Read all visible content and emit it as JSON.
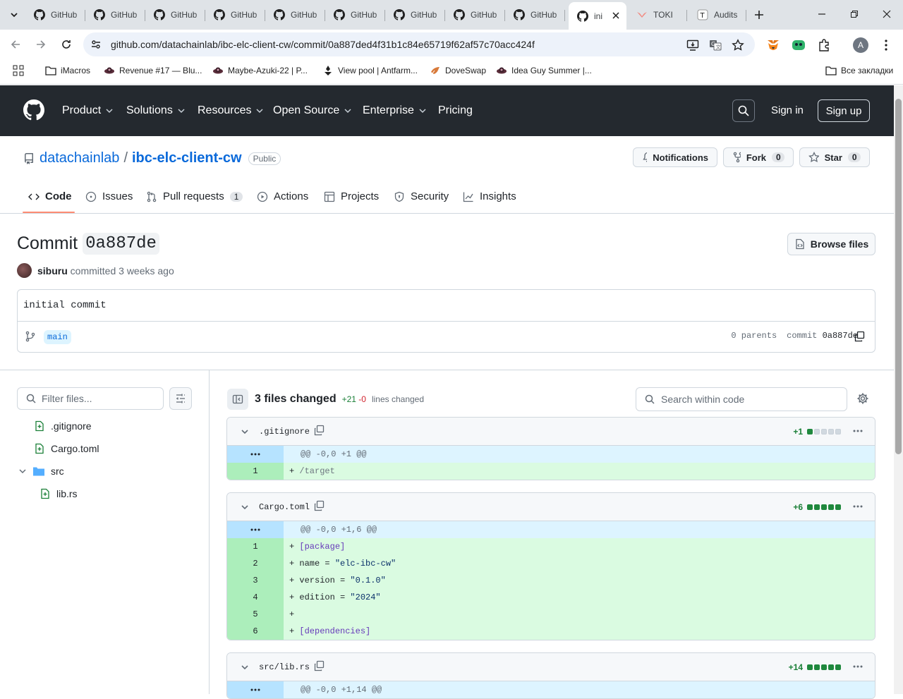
{
  "browser": {
    "tabs": [
      {
        "title": "GitHub",
        "icon": "github-icon"
      },
      {
        "title": "GitHub",
        "icon": "github-icon"
      },
      {
        "title": "GitHub",
        "icon": "github-icon"
      },
      {
        "title": "GitHub",
        "icon": "github-icon"
      },
      {
        "title": "GitHub",
        "icon": "github-icon"
      },
      {
        "title": "GitHub",
        "icon": "github-icon"
      },
      {
        "title": "GitHub",
        "icon": "github-icon"
      },
      {
        "title": "GitHub",
        "icon": "github-icon"
      },
      {
        "title": "GitHub",
        "icon": "github-icon"
      },
      {
        "title": "ini",
        "icon": "github-icon",
        "active": true
      },
      {
        "title": "TOKI",
        "icon": "toki-icon"
      },
      {
        "title": "Audits",
        "icon": "t-icon"
      }
    ],
    "url": "github.com/datachainlab/ibc-elc-client-cw/commit/0a887ded4f31b1c84e65719f62af57c70acc424f",
    "avatar_letter": "A",
    "bookmarks": [
      {
        "label": "iMacros",
        "icon": "folder-icon"
      },
      {
        "label": "Revenue #17 — Blu...",
        "icon": "ufo-icon"
      },
      {
        "label": "Maybe-Azuki-22 | P...",
        "icon": "ufo-icon"
      },
      {
        "label": "View pool | Antfarm...",
        "icon": "antfarm-icon"
      },
      {
        "label": "DoveSwap",
        "icon": "dove-icon"
      },
      {
        "label": "Idea Guy Summer |...",
        "icon": "ufo-icon"
      }
    ],
    "all_bookmarks": "Все закладки"
  },
  "gh_header": {
    "nav": [
      {
        "label": "Product",
        "dropdown": true
      },
      {
        "label": "Solutions",
        "dropdown": true
      },
      {
        "label": "Resources",
        "dropdown": true
      },
      {
        "label": "Open Source",
        "dropdown": true
      },
      {
        "label": "Enterprise",
        "dropdown": true
      },
      {
        "label": "Pricing",
        "dropdown": false
      }
    ],
    "signin": "Sign in",
    "signup": "Sign up"
  },
  "repo": {
    "owner": "datachainlab",
    "name": "ibc-elc-client-cw",
    "visibility": "Public",
    "notifications": "Notifications",
    "fork_label": "Fork",
    "fork_count": "0",
    "star_label": "Star",
    "star_count": "0",
    "tabs": [
      {
        "label": "Code",
        "icon": "code-icon",
        "selected": true
      },
      {
        "label": "Issues",
        "icon": "issue-icon"
      },
      {
        "label": "Pull requests",
        "icon": "pull-request-icon",
        "count": "1"
      },
      {
        "label": "Actions",
        "icon": "play-icon"
      },
      {
        "label": "Projects",
        "icon": "table-icon"
      },
      {
        "label": "Security",
        "icon": "shield-icon"
      },
      {
        "label": "Insights",
        "icon": "graph-icon"
      }
    ]
  },
  "commit": {
    "title_prefix": "Commit",
    "short_sha": "0a887de",
    "browse_files": "Browse files",
    "author": "siburu",
    "committed": "committed",
    "when": "3 weeks ago",
    "message": "initial commit",
    "branch": "main",
    "parents": "0 parents",
    "commit_label": "commit",
    "commit_sha": "0a887de"
  },
  "file_tree": {
    "filter_placeholder": "Filter files...",
    "items": [
      {
        "name": ".gitignore",
        "type": "file-added"
      },
      {
        "name": "Cargo.toml",
        "type": "file-added"
      },
      {
        "name": "src",
        "type": "folder"
      },
      {
        "name": "lib.rs",
        "type": "file-added"
      }
    ]
  },
  "diff": {
    "files_changed": "3 files changed",
    "additions": "+21",
    "deletions": "-0",
    "lines_changed": "lines changed",
    "search_placeholder": "Search within code",
    "colors": {
      "add_bg": "#dafbe1",
      "add_gutter": "#aceebb",
      "hunk_bg": "#ddf4ff",
      "hunk_gutter": "#b6e3ff"
    },
    "files": [
      {
        "name": ".gitignore",
        "stat": "+1",
        "hunk": "@@ -0,0 +1 @@",
        "lines": [
          {
            "n": "1",
            "text": "+ /target",
            "style": "tg"
          }
        ]
      },
      {
        "name": "Cargo.toml",
        "stat": "+6",
        "hunk": "@@ -0,0 +1,6 @@",
        "lines": [
          {
            "n": "1",
            "text": "+ [package]",
            "style": "kw"
          },
          {
            "n": "2",
            "text": "+ name = \"elc-ibc-cw\"",
            "style": ""
          },
          {
            "n": "3",
            "text": "+ version = \"0.1.0\"",
            "style": ""
          },
          {
            "n": "4",
            "text": "+ edition = \"2024\"",
            "style": ""
          },
          {
            "n": "5",
            "text": "+",
            "style": ""
          },
          {
            "n": "6",
            "text": "+ [dependencies]",
            "style": "kw"
          }
        ]
      },
      {
        "name": "src/lib.rs",
        "stat": "+14",
        "hunk": "@@ -0,0 +1,14 @@",
        "lines": []
      }
    ]
  }
}
